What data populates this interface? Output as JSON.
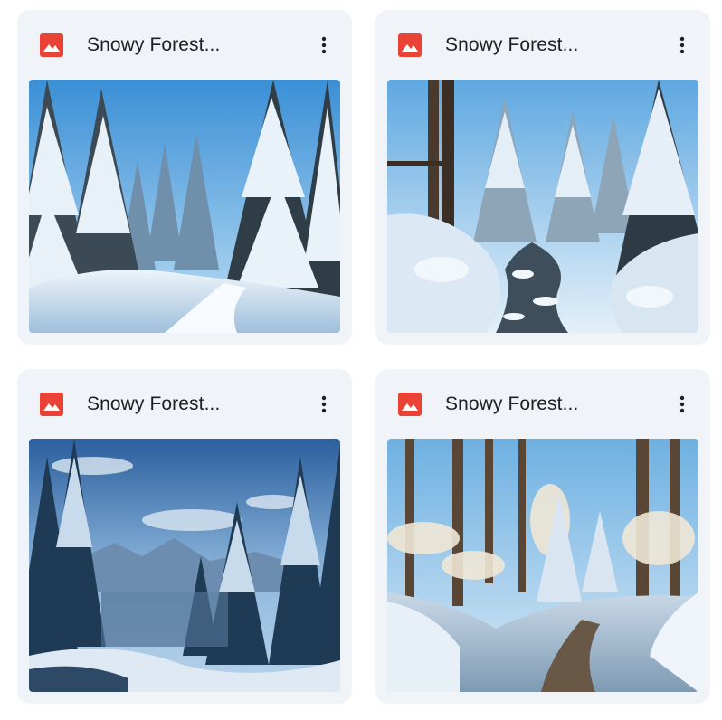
{
  "files": [
    {
      "title": "Snowy Forest...",
      "icon": "image-file-icon",
      "menu_icon": "more-vert-icon",
      "scene": "forest-path"
    },
    {
      "title": "Snowy Forest...",
      "icon": "image-file-icon",
      "menu_icon": "more-vert-icon",
      "scene": "forest-stream"
    },
    {
      "title": "Snowy Forest...",
      "icon": "image-file-icon",
      "menu_icon": "more-vert-icon",
      "scene": "mountain-valley"
    },
    {
      "title": "Snowy Forest...",
      "icon": "image-file-icon",
      "menu_icon": "more-vert-icon",
      "scene": "forest-trail"
    }
  ],
  "colors": {
    "card_bg": "#f0f4f9",
    "icon_red": "#ea4335",
    "text": "#1f1f1f"
  }
}
